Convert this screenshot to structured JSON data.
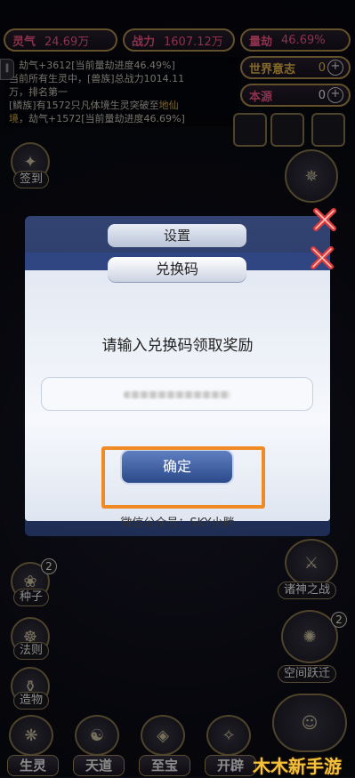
{
  "resources": {
    "lingqi": {
      "label": "灵气",
      "value": "24.69万"
    },
    "zhanli": {
      "label": "战力",
      "value": "1607.12万"
    },
    "liangjie": {
      "label": "量劫",
      "value": "46.69%"
    },
    "shijie": {
      "label": "世界意志",
      "value": "0"
    },
    "benyuan": {
      "label": "本源",
      "value": "0"
    }
  },
  "log": {
    "line1": "，劫气+3612[当前量劫进度46.49%]",
    "line2": "当前所有生灵中，[兽族]总战力1014.11",
    "line3": "万，排名第一",
    "line4a": "[鳞族]有1572只凡体境生灵突破至",
    "line4b": "地仙",
    "line5a": "境",
    "line5b": "，劫气+1572[当前量劫进度46.69%]"
  },
  "left_icons": {
    "sign": "签到",
    "seed": "种子",
    "seed_badge": "2",
    "rule": "法则",
    "creation": "造物"
  },
  "right_icons": {
    "gods_war": "诸神之战",
    "space_jump": "空间跃迁",
    "space_badge": "2"
  },
  "bottom_tabs": [
    "生灵",
    "天道",
    "至宝",
    "开辟"
  ],
  "settings_dialog": {
    "title": "设置"
  },
  "redeem_dialog": {
    "title": "兑换码",
    "prompt": "请输入兑换码领取奖励",
    "confirm": "确定",
    "wechat": "微信公众号：SKY小胖"
  },
  "watermark": "木木新手游",
  "colors": {
    "accent_pink": "#ff5b8a",
    "gold": "#f0c04a",
    "highlight_orange": "#f08a24"
  }
}
